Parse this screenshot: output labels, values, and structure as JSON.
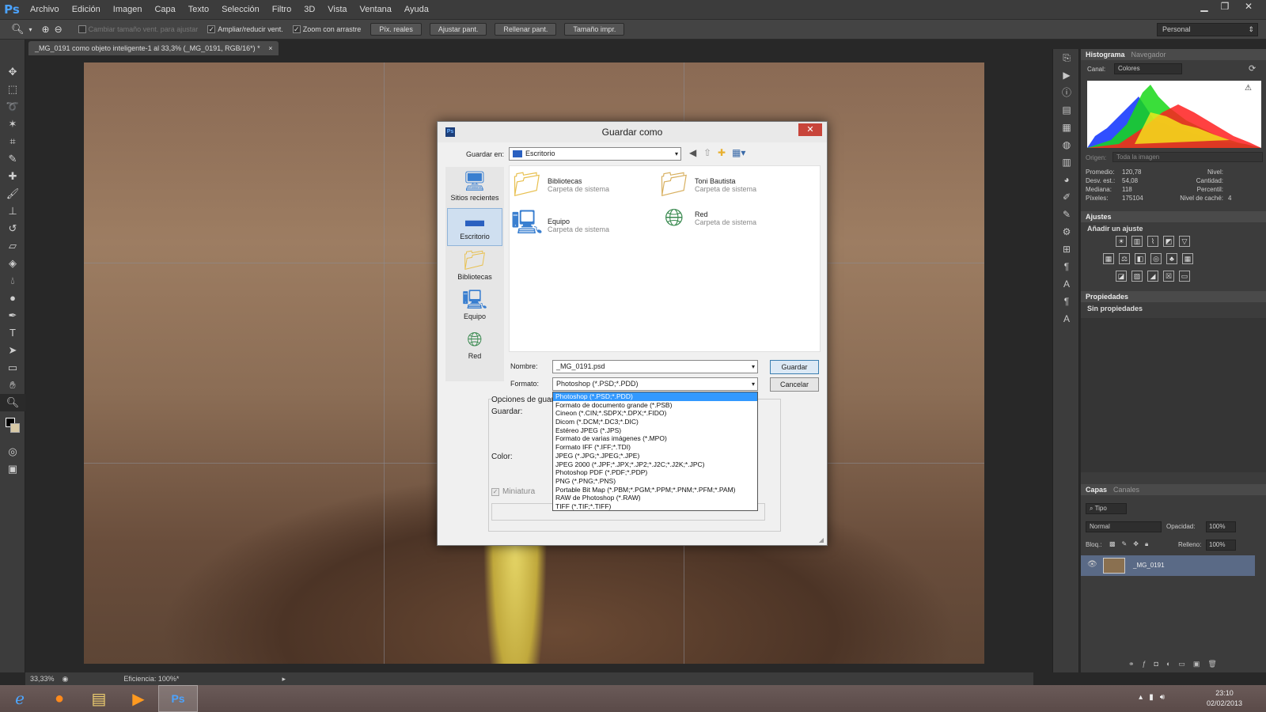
{
  "app": {
    "logo": "Ps"
  },
  "menu": [
    "Archivo",
    "Edición",
    "Imagen",
    "Capa",
    "Texto",
    "Selección",
    "Filtro",
    "3D",
    "Vista",
    "Ventana",
    "Ayuda"
  ],
  "options_bar": {
    "check_resize": "Cambiar tamaño vent. para ajustar",
    "check_zoom_window": "Ampliar/reducir vent.",
    "check_scrubby": "Zoom con arrastre",
    "btn_actual": "Píx. reales",
    "btn_fit": "Ajustar pant.",
    "btn_fill": "Rellenar pant.",
    "btn_print": "Tamaño impr.",
    "workspace": "Personal"
  },
  "document": {
    "tab_title": "_MG_0191 como objeto inteligente-1 al 33,3% (_MG_0191, RGB/16*) *"
  },
  "statusbar": {
    "zoom": "33,33%",
    "info": "Eficiencia: 100%*"
  },
  "histogram": {
    "tab_active": "Histograma",
    "tab_other": "Navegador",
    "canal_label": "Canal:",
    "canal_value": "Colores",
    "origen_label": "Origen:",
    "origen_value": "Toda la imagen",
    "stats": {
      "promedio_label": "Promedio:",
      "promedio": "120,78",
      "desv_label": "Desv. est.:",
      "desv": "54,08",
      "mediana_label": "Mediana:",
      "mediana": "118",
      "pixeles_label": "Píxeles:",
      "pixeles": "175104",
      "nivel_label": "Nivel:",
      "cantidad_label": "Cantidad:",
      "percentil_label": "Percentil:",
      "cache_label": "Nivel de caché:",
      "cache": "4"
    }
  },
  "adjustments": {
    "title": "Ajustes",
    "subtitle": "Añadir un ajuste"
  },
  "properties": {
    "title": "Propiedades",
    "empty": "Sin propiedades"
  },
  "layers": {
    "tab_active": "Capas",
    "tab_other": "Canales",
    "filter": "Tipo",
    "blend": "Normal",
    "opacity_label": "Opacidad:",
    "opacity": "100%",
    "lock_label": "Bloq.:",
    "fill_label": "Relleno:",
    "fill": "100%",
    "layer_name": "_MG_0191"
  },
  "dialog": {
    "title": "Guardar como",
    "save_in_label": "Guardar en:",
    "save_in_value": "Escritorio",
    "places": [
      "Sitios recientes",
      "Escritorio",
      "Bibliotecas",
      "Equipo",
      "Red"
    ],
    "files": [
      {
        "name": "Bibliotecas",
        "type": "Carpeta de sistema"
      },
      {
        "name": "Toni Bautista",
        "type": "Carpeta de sistema"
      },
      {
        "name": "Equipo",
        "type": "Carpeta de sistema"
      },
      {
        "name": "Red",
        "type": "Carpeta de sistema"
      }
    ],
    "name_label": "Nombre:",
    "name_value": "_MG_0191.psd",
    "format_label": "Formato:",
    "format_value": "Photoshop (*.PSD;*.PDD)",
    "save_btn": "Guardar",
    "cancel_btn": "Cancelar",
    "options_label": "Opciones de guar",
    "save_label": "Guardar:",
    "color_label": "Color:",
    "thumbnail_label": "Miniatura",
    "format_options": [
      "Photoshop (*.PSD;*.PDD)",
      "Formato de documento grande (*.PSB)",
      "Cineon (*.CIN;*.SDPX;*.DPX;*.FIDO)",
      "Dicom (*.DCM;*.DC3;*.DIC)",
      "Estéreo JPEG (*.JPS)",
      "Formato de varias imágenes (*.MPO)",
      "Formato IFF (*.IFF;*.TDI)",
      "JPEG (*.JPG;*.JPEG;*.JPE)",
      "JPEG 2000 (*.JPF;*.JPX;*.JP2;*.J2C;*.J2K;*.JPC)",
      "Photoshop PDF (*.PDF;*.PDP)",
      "PNG (*.PNG;*.PNS)",
      "Portable Bit Map (*.PBM;*.PGM;*.PPM;*.PNM;*.PFM;*.PAM)",
      "RAW de Photoshop (*.RAW)",
      "TIFF (*.TIF;*.TIFF)"
    ]
  },
  "taskbar": {
    "time": "23:10",
    "date": "02/02/2013"
  }
}
